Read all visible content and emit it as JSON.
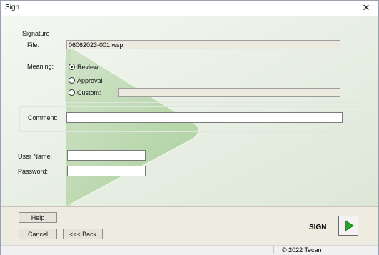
{
  "window": {
    "title": "Sign",
    "close_glyph": "✕"
  },
  "signature": {
    "group_label": "Signature",
    "file_label": "File:",
    "file_value": "06062023-001.wsp",
    "meaning_label": "Meaning:",
    "options": [
      {
        "label": "Review",
        "selected": true
      },
      {
        "label": "Approval",
        "selected": false
      },
      {
        "label": "Custom:",
        "selected": false
      }
    ],
    "custom_value": "",
    "comment_label": "Comment:",
    "comment_value": ""
  },
  "credentials": {
    "username_label": "User Name:",
    "username_value": "",
    "password_label": "Password:",
    "password_value": ""
  },
  "footer": {
    "help_label": "Help",
    "cancel_label": "Cancel",
    "back_label": "<<< Back",
    "sign_label": "SIGN",
    "sign_icon": "play-icon",
    "accent_color": "#2aa52a"
  },
  "status": {
    "copyright": "© 2022 Tecan"
  }
}
